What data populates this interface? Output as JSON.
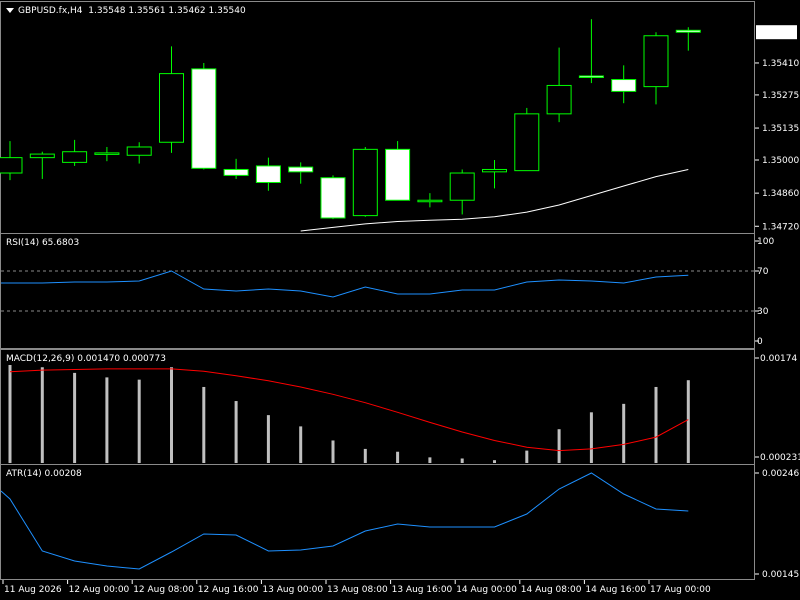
{
  "main": {
    "symbol_label": "GBPUSD.fx,H4",
    "ohlc_label": "1.35548 1.35561 1.35462 1.35540",
    "current_price": "1.35540",
    "price_ticks": [
      "1.35410",
      "1.35275",
      "1.35135",
      "1.35000",
      "1.34860",
      "1.34720"
    ]
  },
  "rsi": {
    "label": "RSI(14) 65.6803",
    "levels": [
      "100",
      "70",
      "30",
      "0"
    ]
  },
  "macd": {
    "label": "MACD(12,26,9) 0.001470 0.000773",
    "ticks": [
      "0.00174",
      "0.000231"
    ]
  },
  "atr": {
    "label": "ATR(14) 0.00208",
    "ticks": [
      "0.00246",
      "0.00145"
    ]
  },
  "time_labels": [
    "11 Aug 2026",
    "12 Aug 00:00",
    "12 Aug 08:00",
    "12 Aug 16:00",
    "13 Aug 00:00",
    "13 Aug 08:00",
    "13 Aug 16:00",
    "14 Aug 00:00",
    "14 Aug 08:00",
    "14 Aug 16:00",
    "17 Aug 00:00"
  ],
  "colors": {
    "bull": "#ffffff",
    "bear": "#000000",
    "candle_outline": "#00ff00",
    "ma_line": "#ffffff",
    "rsi_line": "#1e90ff",
    "macd_hist": "#c0c0c0",
    "macd_signal": "#ff0000",
    "atr_line": "#1e90ff"
  },
  "chart_data": {
    "type": "candlestick",
    "candles": [
      {
        "o": 1.34945,
        "h": 1.3508,
        "l": 1.34915,
        "c": 1.3501
      },
      {
        "o": 1.3501,
        "h": 1.35035,
        "l": 1.3492,
        "c": 1.35025
      },
      {
        "o": 1.3499,
        "h": 1.35085,
        "l": 1.34975,
        "c": 1.35035
      },
      {
        "o": 1.3503,
        "h": 1.35055,
        "l": 1.34995,
        "c": 1.3503
      },
      {
        "o": 1.3502,
        "h": 1.35075,
        "l": 1.34985,
        "c": 1.35055
      },
      {
        "o": 1.35075,
        "h": 1.3548,
        "l": 1.3503,
        "c": 1.35365
      },
      {
        "o": 1.35385,
        "h": 1.3541,
        "l": 1.3496,
        "c": 1.34965
      },
      {
        "o": 1.3496,
        "h": 1.35005,
        "l": 1.3492,
        "c": 1.34935
      },
      {
        "o": 1.34975,
        "h": 1.3501,
        "l": 1.3487,
        "c": 1.34905
      },
      {
        "o": 1.3497,
        "h": 1.3499,
        "l": 1.349,
        "c": 1.3495
      },
      {
        "o": 1.34925,
        "h": 1.34935,
        "l": 1.3475,
        "c": 1.34755
      },
      {
        "o": 1.34765,
        "h": 1.35055,
        "l": 1.3476,
        "c": 1.35045
      },
      {
        "o": 1.35045,
        "h": 1.3508,
        "l": 1.3483,
        "c": 1.3483
      },
      {
        "o": 1.3483,
        "h": 1.3486,
        "l": 1.348,
        "c": 1.3483
      },
      {
        "o": 1.3483,
        "h": 1.3496,
        "l": 1.3477,
        "c": 1.34945
      },
      {
        "o": 1.3495,
        "h": 1.35,
        "l": 1.3488,
        "c": 1.3496
      },
      {
        "o": 1.34955,
        "h": 1.3522,
        "l": 1.34955,
        "c": 1.35195
      },
      {
        "o": 1.35195,
        "h": 1.35475,
        "l": 1.3516,
        "c": 1.35315
      },
      {
        "o": 1.35355,
        "h": 1.35595,
        "l": 1.35325,
        "c": 1.3535
      },
      {
        "o": 1.3534,
        "h": 1.354,
        "l": 1.3524,
        "c": 1.3529
      },
      {
        "o": 1.3531,
        "h": 1.3554,
        "l": 1.35235,
        "c": 1.35525
      },
      {
        "o": 1.35548,
        "h": 1.35561,
        "l": 1.35462,
        "c": 1.3554
      }
    ],
    "moving_average": [
      1.347,
      1.34715,
      1.3473,
      1.3474,
      1.34745,
      1.3475,
      1.3476,
      1.3478,
      1.3481,
      1.3485,
      1.3489,
      1.3493,
      1.3496
    ],
    "rsi": [
      58,
      58,
      59,
      59,
      60,
      70,
      52,
      50,
      52,
      50,
      44,
      54,
      47,
      47,
      51,
      51,
      59,
      61,
      60,
      58,
      64,
      65.68
    ],
    "macd_hist": [
      0.00174,
      0.0017,
      0.0016,
      0.00152,
      0.00148,
      0.0017,
      0.00135,
      0.0011,
      0.00085,
      0.00065,
      0.0004,
      0.00025,
      0.0002,
      0.0001,
      8e-05,
      5e-05,
      0.00022,
      0.0006,
      0.0009,
      0.00105,
      0.00135,
      0.00147
    ],
    "macd_signal": [
      0.00162,
      0.00165,
      0.00166,
      0.00167,
      0.00167,
      0.00167,
      0.00163,
      0.00155,
      0.00146,
      0.00135,
      0.00122,
      0.00107,
      0.0009,
      0.00072,
      0.00055,
      0.0004,
      0.00028,
      0.00022,
      0.00025,
      0.00033,
      0.00046,
      0.00077
    ],
    "atr": [
      0.0022,
      0.00168,
      0.00158,
      0.00153,
      0.0015,
      0.00167,
      0.00185,
      0.00184,
      0.00168,
      0.00169,
      0.00173,
      0.00188,
      0.00195,
      0.00192,
      0.00192,
      0.00192,
      0.00205,
      0.0023,
      0.00246,
      0.00225,
      0.0021,
      0.00208
    ]
  }
}
